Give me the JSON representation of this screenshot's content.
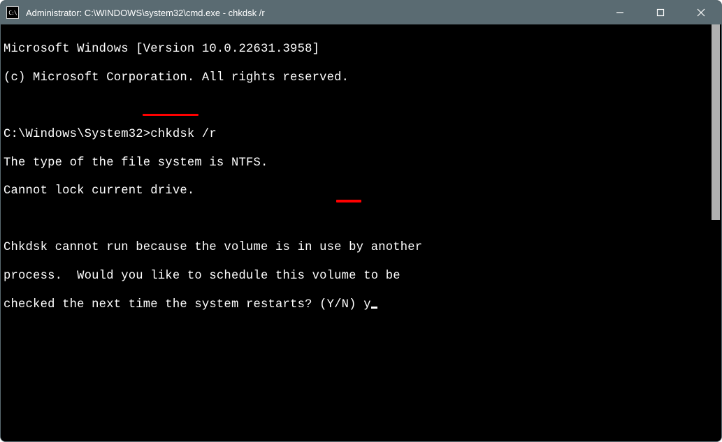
{
  "window": {
    "title": "Administrator: C:\\WINDOWS\\system32\\cmd.exe - chkdsk  /r",
    "icon_label": "C:\\"
  },
  "terminal": {
    "line1": "Microsoft Windows [Version 10.0.22631.3958]",
    "line2": "(c) Microsoft Corporation. All rights reserved.",
    "blank1": "",
    "prompt_prefix": "C:\\Windows\\System32>",
    "command": "chkdsk /r",
    "line4": "The type of the file system is NTFS.",
    "line5": "Cannot lock current drive.",
    "blank2": "",
    "line6": "Chkdsk cannot run because the volume is in use by another",
    "line7": "process.  Would you like to schedule this volume to be",
    "line8_prefix": "checked the next time the system restarts? (Y/N) ",
    "user_input": "y"
  }
}
